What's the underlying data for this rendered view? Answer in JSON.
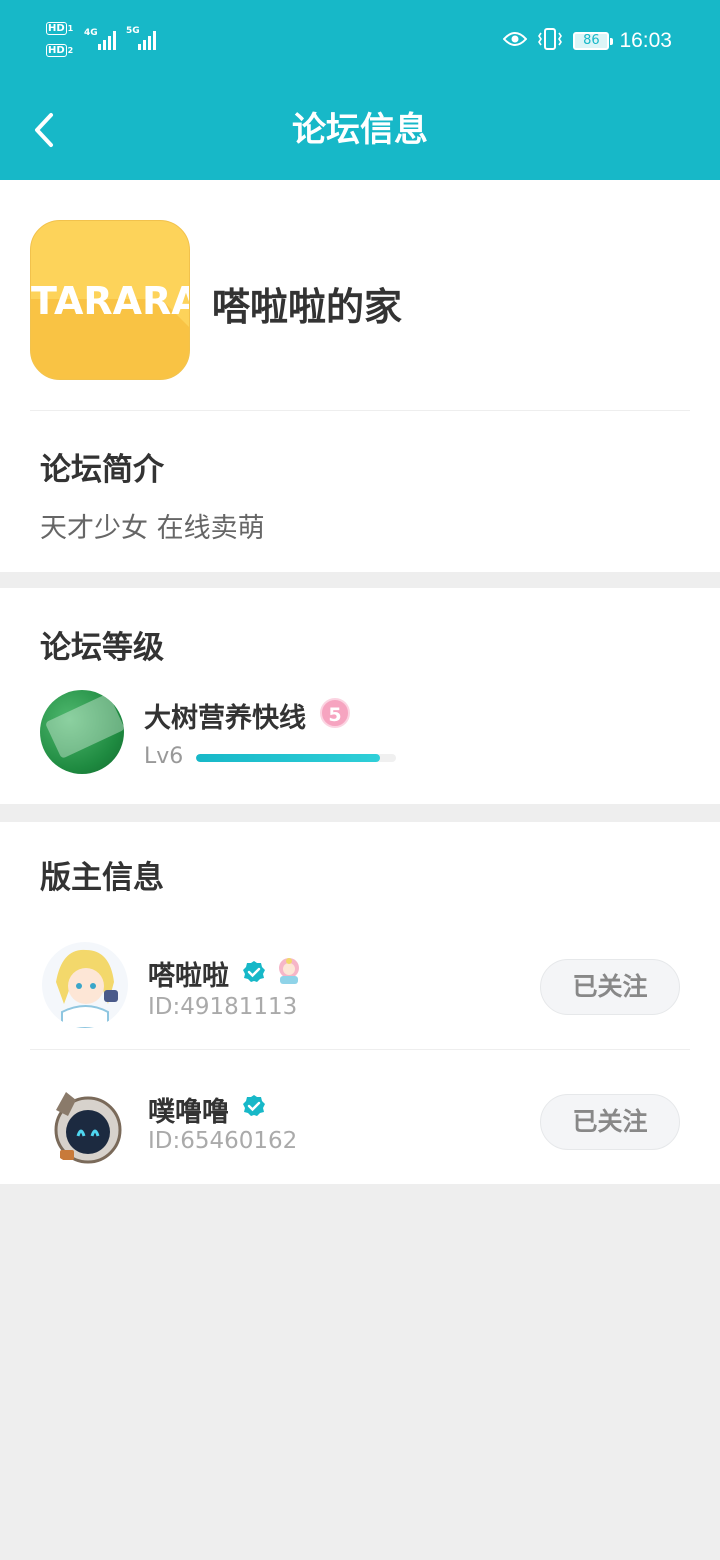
{
  "status_bar": {
    "sim1": "HD",
    "sim1_index": "1",
    "sim2": "HD",
    "sim2_index": "2",
    "network1": "4G",
    "network2": "5G",
    "battery": "86",
    "time": "16:03"
  },
  "nav": {
    "title": "论坛信息"
  },
  "forum": {
    "logo_text": "TARARA",
    "name": "嗒啦啦的家"
  },
  "intro": {
    "title": "论坛简介",
    "text": "天才少女 在线卖萌"
  },
  "level": {
    "title": "论坛等级",
    "name": "大树营养快线",
    "badge": "5",
    "label": "Lv6",
    "progress": 0.92
  },
  "moderators": {
    "title": "版主信息",
    "items": [
      {
        "name": "嗒啦啦",
        "id": "ID:49181113",
        "follow_label": "已关注"
      },
      {
        "name": "噗噜噜",
        "id": "ID:65460162",
        "follow_label": "已关注"
      }
    ]
  },
  "colors": {
    "accent": "#17b8c8",
    "background": "#eeeeee"
  }
}
